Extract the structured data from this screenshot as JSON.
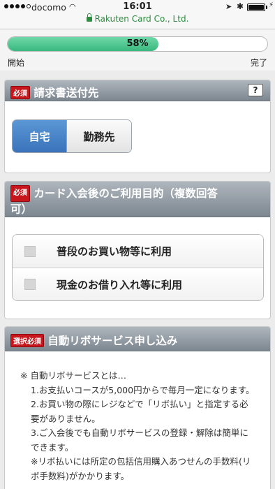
{
  "status_bar": {
    "carrier": "docomo",
    "time": "16:01"
  },
  "browser": {
    "url": "Rakuten Card Co., Ltd."
  },
  "progress": {
    "percent_label": "58%",
    "value": 0.58,
    "start_label": "開始",
    "end_label": "完了"
  },
  "billing_section": {
    "badge": "必須",
    "title": "請求書送付先",
    "help_label": "?",
    "options": [
      "自宅",
      "勤務先"
    ],
    "selected": "自宅"
  },
  "purpose_section": {
    "badge": "必須",
    "title_line1": "カード入会後のご利用目的（複数回答",
    "title_line2": "可）",
    "options": [
      "普段のお買い物等に利用",
      "現金のお借り入れ等に利用"
    ]
  },
  "revo_section": {
    "badge": "選択必須",
    "title": "自動リボサービス申し込み",
    "lines": [
      "※ 自動リボサービスとは…",
      "1.お支払いコースが5,000円からで毎月一定になります。",
      "2.お買い物の際にレジなどで「リボ払い」と指定する必",
      "要がありません。",
      "3.ご入会後でも自動リボサービスの登録・解除は簡単に",
      "できます。",
      "※リボ払いには所定の包括信用購入あつせんの手数料(リ",
      "ボ手数料)がかかります。"
    ]
  }
}
